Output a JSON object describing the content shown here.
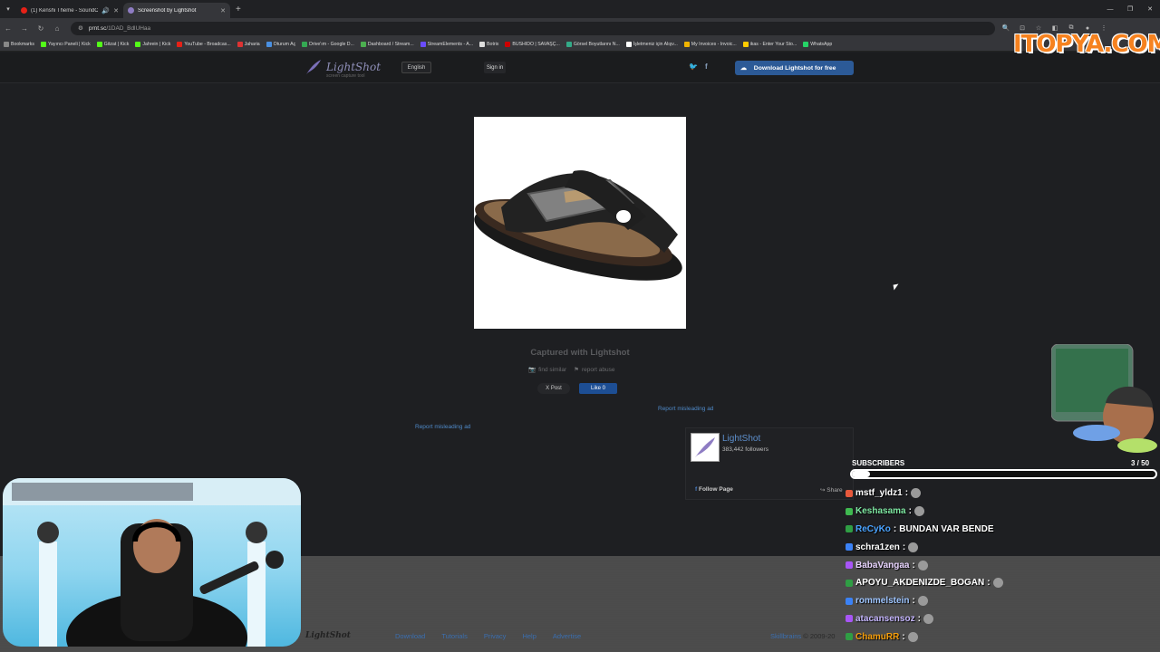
{
  "browser": {
    "tabs": [
      {
        "title": "(1) Kenshi Theme - SoundC",
        "fav_color": "#e62117"
      },
      {
        "title": "Screenshot by Lightshot",
        "fav_color": "#8e7cc3"
      }
    ],
    "url_host": "prnt.sc",
    "url_path": "/1DAD_BdlUHaa",
    "bookmarks": [
      {
        "label": "Bookmarks",
        "color": "#888"
      },
      {
        "label": "Yayıncı Paneli | Kick",
        "color": "#53fc18"
      },
      {
        "label": "Gitzat | Kick",
        "color": "#53fc18"
      },
      {
        "label": "Jahrein | Kick",
        "color": "#53fc18"
      },
      {
        "label": "YouTube - Broadcas...",
        "color": "#e62117"
      },
      {
        "label": "Jaharia",
        "color": "#d33"
      },
      {
        "label": "Oturum Aç",
        "color": "#4a90e2"
      },
      {
        "label": "Drive'ım - Google D...",
        "color": "#34a853"
      },
      {
        "label": "Dashboard / Stream...",
        "color": "#4caf50"
      },
      {
        "label": "StreamElements - A...",
        "color": "#6a4cff"
      },
      {
        "label": "Botrix",
        "color": "#ddd"
      },
      {
        "label": "BUSHIDO | SAVAŞÇ...",
        "color": "#c00"
      },
      {
        "label": "Görsel Boyutlarını N...",
        "color": "#3a8"
      },
      {
        "label": "İşletmeniz için Alışv...",
        "color": "#fff"
      },
      {
        "label": "My Invoices - Invoic...",
        "color": "#f0b400"
      },
      {
        "label": "ikas - Enter Your Sto...",
        "color": "#ffcc00"
      },
      {
        "label": "WhatsApp",
        "color": "#25d366"
      }
    ]
  },
  "lightshot": {
    "logo": "LightShot",
    "tagline": "screen capture tool",
    "language": "English",
    "signin": "Sign in",
    "download": "Download Lightshot for free",
    "captured": "Captured with Lightshot",
    "find_similar": "find similar",
    "report_abuse": "report abuse",
    "x_post": "X Post",
    "fb_like": "Like 0",
    "report_ad_1": "Report misleading ad",
    "report_ad_2": "Report misleading ad",
    "fb_page": {
      "name": "LightShot",
      "followers": "383,442 followers",
      "follow": "Follow Page",
      "share": "Share"
    },
    "footer": {
      "logo": "LightShot",
      "links": [
        "Download",
        "Tutorials",
        "Privacy",
        "Help",
        "Advertise"
      ],
      "company": "Skillbrains",
      "copy": " © 2009-20"
    }
  },
  "overlay": {
    "brand": "ITOPYA.COM",
    "subs_label": "SUBSCRIBERS",
    "subs_count": "3  / 50",
    "subs_progress": 0.06,
    "chat": [
      {
        "user": "mstf_yldz1",
        "color": "#ffffff",
        "badge": "#e8593c",
        "text": ""
      },
      {
        "user": "Keshasama",
        "color": "#7ee8a2",
        "badge": "#3fb950",
        "text": ""
      },
      {
        "user": "ReCyKo",
        "color": "#4aa3ff",
        "badge": "#2f9e44",
        "text": "BUNDAN VAR BENDE"
      },
      {
        "user": "schra1zen",
        "color": "#ffffff",
        "badge": "#3b82f6",
        "text": ""
      },
      {
        "user": "BabaVangaa",
        "color": "#e9d5ff",
        "badge": "#a855f7",
        "text": ""
      },
      {
        "user": "APOYU_AKDENIZDE_BOGAN",
        "color": "#ffffff",
        "badge": "#2f9e44",
        "text": ""
      },
      {
        "user": "rommelstein",
        "color": "#9ec5ff",
        "badge": "#3b82f6",
        "text": ""
      },
      {
        "user": "atacansensoz",
        "color": "#c4b5fd",
        "badge": "#a855f7",
        "text": ""
      },
      {
        "user": "ChamuRR",
        "color": "#f59e0b",
        "badge": "#2f9e44",
        "text": ""
      }
    ]
  }
}
